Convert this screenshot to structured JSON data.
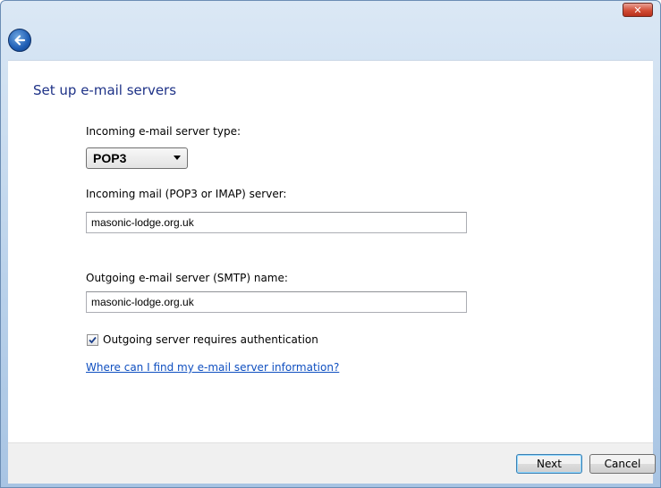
{
  "window": {
    "close_glyph": "✕",
    "back_icon": "back-arrow-icon"
  },
  "page": {
    "title": "Set up e-mail servers"
  },
  "incoming_type": {
    "label": "Incoming e-mail server type:",
    "selected": "POP3"
  },
  "incoming_server": {
    "label": "Incoming mail (POP3 or IMAP) server:",
    "value": "masonic-lodge.org.uk"
  },
  "outgoing_server": {
    "label": "Outgoing e-mail server (SMTP) name:",
    "value": "masonic-lodge.org.uk"
  },
  "auth_checkbox": {
    "label": "Outgoing server requires authentication",
    "checked": true
  },
  "help_link": {
    "text": "Where can I find my e-mail server information?"
  },
  "footer": {
    "next_label": "Next",
    "cancel_label": "Cancel"
  },
  "colors": {
    "title_blue": "#1e3287",
    "link_blue": "#0f4fc0",
    "close_red": "#d24d36"
  }
}
